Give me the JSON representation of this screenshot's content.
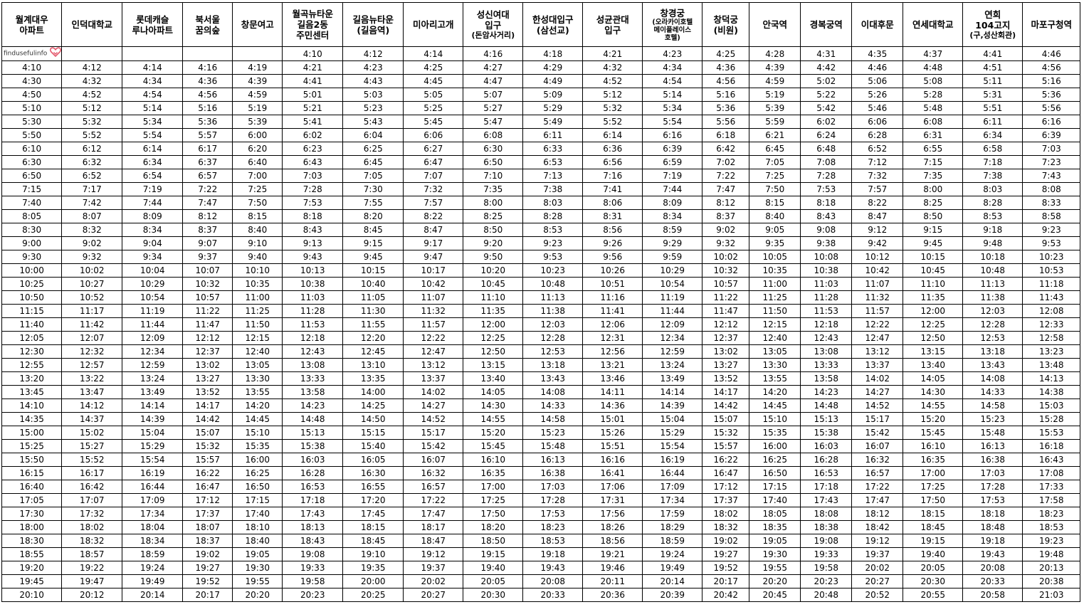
{
  "watermark": {
    "text": "findusefulinfo",
    "icon": "heart-icon",
    "icon_color": "#e45b6e"
  },
  "headers": [
    {
      "main": "월계대우\n아파트"
    },
    {
      "main": "인덕대학교"
    },
    {
      "main": "롯데캐슬\n루나아파트"
    },
    {
      "main": "북서울\n꿈의숲"
    },
    {
      "main": "창문여고"
    },
    {
      "main": "월곡뉴타운\n길음2동\n주민센터"
    },
    {
      "main": "길음뉴타운\n(길음역)"
    },
    {
      "main": "미아리고개"
    },
    {
      "main": "성신여대\n입구",
      "sub": "(돈암사거리)"
    },
    {
      "main": "한성대입구\n(삼선교)"
    },
    {
      "main": "성균관대\n입구"
    },
    {
      "main": "창경궁",
      "tiny": "(오라카이호텔\n메이플레이스\n호텔)"
    },
    {
      "main": "창덕궁\n(비원)"
    },
    {
      "main": "안국역"
    },
    {
      "main": "경복궁역"
    },
    {
      "main": "이대후문"
    },
    {
      "main": "연세대학교"
    },
    {
      "main": "연희\n104고지",
      "sub": "(구,성산회관)"
    },
    {
      "main": "마포구청역"
    }
  ],
  "first_row": [
    "",
    "",
    "",
    "",
    "",
    "4:10",
    "4:12",
    "4:14",
    "4:16",
    "4:18",
    "4:21",
    "4:23",
    "4:25",
    "4:28",
    "4:31",
    "4:35",
    "4:37",
    "4:41",
    "4:46"
  ],
  "rows": [
    [
      "4:10",
      "4:12",
      "4:14",
      "4:16",
      "4:19",
      "4:21",
      "4:23",
      "4:25",
      "4:27",
      "4:29",
      "4:32",
      "4:34",
      "4:36",
      "4:39",
      "4:42",
      "4:46",
      "4:48",
      "4:51",
      "4:56"
    ],
    [
      "4:30",
      "4:32",
      "4:34",
      "4:36",
      "4:39",
      "4:41",
      "4:43",
      "4:45",
      "4:47",
      "4:49",
      "4:52",
      "4:54",
      "4:56",
      "4:59",
      "5:02",
      "5:06",
      "5:08",
      "5:11",
      "5:16"
    ],
    [
      "4:50",
      "4:52",
      "4:54",
      "4:56",
      "4:59",
      "5:01",
      "5:03",
      "5:05",
      "5:07",
      "5:09",
      "5:12",
      "5:14",
      "5:16",
      "5:19",
      "5:22",
      "5:26",
      "5:28",
      "5:31",
      "5:36"
    ],
    [
      "5:10",
      "5:12",
      "5:14",
      "5:16",
      "5:19",
      "5:21",
      "5:23",
      "5:25",
      "5:27",
      "5:29",
      "5:32",
      "5:34",
      "5:36",
      "5:39",
      "5:42",
      "5:46",
      "5:48",
      "5:51",
      "5:56"
    ],
    [
      "5:30",
      "5:32",
      "5:34",
      "5:36",
      "5:39",
      "5:41",
      "5:43",
      "5:45",
      "5:47",
      "5:49",
      "5:52",
      "5:54",
      "5:56",
      "5:59",
      "6:02",
      "6:06",
      "6:08",
      "6:11",
      "6:16"
    ],
    [
      "5:50",
      "5:52",
      "5:54",
      "5:57",
      "6:00",
      "6:02",
      "6:04",
      "6:06",
      "6:08",
      "6:11",
      "6:14",
      "6:16",
      "6:18",
      "6:21",
      "6:24",
      "6:28",
      "6:31",
      "6:34",
      "6:39"
    ],
    [
      "6:10",
      "6:12",
      "6:14",
      "6:17",
      "6:20",
      "6:23",
      "6:25",
      "6:27",
      "6:30",
      "6:33",
      "6:36",
      "6:39",
      "6:42",
      "6:45",
      "6:48",
      "6:52",
      "6:55",
      "6:58",
      "7:03"
    ],
    [
      "6:30",
      "6:32",
      "6:34",
      "6:37",
      "6:40",
      "6:43",
      "6:45",
      "6:47",
      "6:50",
      "6:53",
      "6:56",
      "6:59",
      "7:02",
      "7:05",
      "7:08",
      "7:12",
      "7:15",
      "7:18",
      "7:23"
    ],
    [
      "6:50",
      "6:52",
      "6:54",
      "6:57",
      "7:00",
      "7:03",
      "7:05",
      "7:07",
      "7:10",
      "7:13",
      "7:16",
      "7:19",
      "7:22",
      "7:25",
      "7:28",
      "7:32",
      "7:35",
      "7:38",
      "7:43"
    ],
    [
      "7:15",
      "7:17",
      "7:19",
      "7:22",
      "7:25",
      "7:28",
      "7:30",
      "7:32",
      "7:35",
      "7:38",
      "7:41",
      "7:44",
      "7:47",
      "7:50",
      "7:53",
      "7:57",
      "8:00",
      "8:03",
      "8:08"
    ],
    [
      "7:40",
      "7:42",
      "7:44",
      "7:47",
      "7:50",
      "7:53",
      "7:55",
      "7:57",
      "8:00",
      "8:03",
      "8:06",
      "8:09",
      "8:12",
      "8:15",
      "8:18",
      "8:22",
      "8:25",
      "8:28",
      "8:33"
    ],
    [
      "8:05",
      "8:07",
      "8:09",
      "8:12",
      "8:15",
      "8:18",
      "8:20",
      "8:22",
      "8:25",
      "8:28",
      "8:31",
      "8:34",
      "8:37",
      "8:40",
      "8:43",
      "8:47",
      "8:50",
      "8:53",
      "8:58"
    ],
    [
      "8:30",
      "8:32",
      "8:34",
      "8:37",
      "8:40",
      "8:43",
      "8:45",
      "8:47",
      "8:50",
      "8:53",
      "8:56",
      "8:59",
      "9:02",
      "9:05",
      "9:08",
      "9:12",
      "9:15",
      "9:18",
      "9:23"
    ],
    [
      "9:00",
      "9:02",
      "9:04",
      "9:07",
      "9:10",
      "9:13",
      "9:15",
      "9:17",
      "9:20",
      "9:23",
      "9:26",
      "9:29",
      "9:32",
      "9:35",
      "9:38",
      "9:42",
      "9:45",
      "9:48",
      "9:53"
    ],
    [
      "9:30",
      "9:32",
      "9:34",
      "9:37",
      "9:40",
      "9:43",
      "9:45",
      "9:47",
      "9:50",
      "9:53",
      "9:56",
      "9:59",
      "10:02",
      "10:05",
      "10:08",
      "10:12",
      "10:15",
      "10:18",
      "10:23"
    ],
    [
      "10:00",
      "10:02",
      "10:04",
      "10:07",
      "10:10",
      "10:13",
      "10:15",
      "10:17",
      "10:20",
      "10:23",
      "10:26",
      "10:29",
      "10:32",
      "10:35",
      "10:38",
      "10:42",
      "10:45",
      "10:48",
      "10:53"
    ],
    [
      "10:25",
      "10:27",
      "10:29",
      "10:32",
      "10:35",
      "10:38",
      "10:40",
      "10:42",
      "10:45",
      "10:48",
      "10:51",
      "10:54",
      "10:57",
      "11:00",
      "11:03",
      "11:07",
      "11:10",
      "11:13",
      "11:18"
    ],
    [
      "10:50",
      "10:52",
      "10:54",
      "10:57",
      "11:00",
      "11:03",
      "11:05",
      "11:07",
      "11:10",
      "11:13",
      "11:16",
      "11:19",
      "11:22",
      "11:25",
      "11:28",
      "11:32",
      "11:35",
      "11:38",
      "11:43"
    ],
    [
      "11:15",
      "11:17",
      "11:19",
      "11:22",
      "11:25",
      "11:28",
      "11:30",
      "11:32",
      "11:35",
      "11:38",
      "11:41",
      "11:44",
      "11:47",
      "11:50",
      "11:53",
      "11:57",
      "12:00",
      "12:03",
      "12:08"
    ],
    [
      "11:40",
      "11:42",
      "11:44",
      "11:47",
      "11:50",
      "11:53",
      "11:55",
      "11:57",
      "12:00",
      "12:03",
      "12:06",
      "12:09",
      "12:12",
      "12:15",
      "12:18",
      "12:22",
      "12:25",
      "12:28",
      "12:33"
    ],
    [
      "12:05",
      "12:07",
      "12:09",
      "12:12",
      "12:15",
      "12:18",
      "12:20",
      "12:22",
      "12:25",
      "12:28",
      "12:31",
      "12:34",
      "12:37",
      "12:40",
      "12:43",
      "12:47",
      "12:50",
      "12:53",
      "12:58"
    ],
    [
      "12:30",
      "12:32",
      "12:34",
      "12:37",
      "12:40",
      "12:43",
      "12:45",
      "12:47",
      "12:50",
      "12:53",
      "12:56",
      "12:59",
      "13:02",
      "13:05",
      "13:08",
      "13:12",
      "13:15",
      "13:18",
      "13:23"
    ],
    [
      "12:55",
      "12:57",
      "12:59",
      "13:02",
      "13:05",
      "13:08",
      "13:10",
      "13:12",
      "13:15",
      "13:18",
      "13:21",
      "13:24",
      "13:27",
      "13:30",
      "13:33",
      "13:37",
      "13:40",
      "13:43",
      "13:48"
    ],
    [
      "13:20",
      "13:22",
      "13:24",
      "13:27",
      "13:30",
      "13:33",
      "13:35",
      "13:37",
      "13:40",
      "13:43",
      "13:46",
      "13:49",
      "13:52",
      "13:55",
      "13:58",
      "14:02",
      "14:05",
      "14:08",
      "14:13"
    ],
    [
      "13:45",
      "13:47",
      "13:49",
      "13:52",
      "13:55",
      "13:58",
      "14:00",
      "14:02",
      "14:05",
      "14:08",
      "14:11",
      "14:14",
      "14:17",
      "14:20",
      "14:23",
      "14:27",
      "14:30",
      "14:33",
      "14:38"
    ],
    [
      "14:10",
      "14:12",
      "14:14",
      "14:17",
      "14:20",
      "14:23",
      "14:25",
      "14:27",
      "14:30",
      "14:33",
      "14:36",
      "14:39",
      "14:42",
      "14:45",
      "14:48",
      "14:52",
      "14:55",
      "14:58",
      "15:03"
    ],
    [
      "14:35",
      "14:37",
      "14:39",
      "14:42",
      "14:45",
      "14:48",
      "14:50",
      "14:52",
      "14:55",
      "14:58",
      "15:01",
      "15:04",
      "15:07",
      "15:10",
      "15:13",
      "15:17",
      "15:20",
      "15:23",
      "15:28"
    ],
    [
      "15:00",
      "15:02",
      "15:04",
      "15:07",
      "15:10",
      "15:13",
      "15:15",
      "15:17",
      "15:20",
      "15:23",
      "15:26",
      "15:29",
      "15:32",
      "15:35",
      "15:38",
      "15:42",
      "15:45",
      "15:48",
      "15:53"
    ],
    [
      "15:25",
      "15:27",
      "15:29",
      "15:32",
      "15:35",
      "15:38",
      "15:40",
      "15:42",
      "15:45",
      "15:48",
      "15:51",
      "15:54",
      "15:57",
      "16:00",
      "16:03",
      "16:07",
      "16:10",
      "16:13",
      "16:18"
    ],
    [
      "15:50",
      "15:52",
      "15:54",
      "15:57",
      "16:00",
      "16:03",
      "16:05",
      "16:07",
      "16:10",
      "16:13",
      "16:16",
      "16:19",
      "16:22",
      "16:25",
      "16:28",
      "16:32",
      "16:35",
      "16:38",
      "16:43"
    ],
    [
      "16:15",
      "16:17",
      "16:19",
      "16:22",
      "16:25",
      "16:28",
      "16:30",
      "16:32",
      "16:35",
      "16:38",
      "16:41",
      "16:44",
      "16:47",
      "16:50",
      "16:53",
      "16:57",
      "17:00",
      "17:03",
      "17:08"
    ],
    [
      "16:40",
      "16:42",
      "16:44",
      "16:47",
      "16:50",
      "16:53",
      "16:55",
      "16:57",
      "17:00",
      "17:03",
      "17:06",
      "17:09",
      "17:12",
      "17:15",
      "17:18",
      "17:22",
      "17:25",
      "17:28",
      "17:33"
    ],
    [
      "17:05",
      "17:07",
      "17:09",
      "17:12",
      "17:15",
      "17:18",
      "17:20",
      "17:22",
      "17:25",
      "17:28",
      "17:31",
      "17:34",
      "17:37",
      "17:40",
      "17:43",
      "17:47",
      "17:50",
      "17:53",
      "17:58"
    ],
    [
      "17:30",
      "17:32",
      "17:34",
      "17:37",
      "17:40",
      "17:43",
      "17:45",
      "17:47",
      "17:50",
      "17:53",
      "17:56",
      "17:59",
      "18:02",
      "18:05",
      "18:08",
      "18:12",
      "18:15",
      "18:18",
      "18:23"
    ],
    [
      "18:00",
      "18:02",
      "18:04",
      "18:07",
      "18:10",
      "18:13",
      "18:15",
      "18:17",
      "18:20",
      "18:23",
      "18:26",
      "18:29",
      "18:32",
      "18:35",
      "18:38",
      "18:42",
      "18:45",
      "18:48",
      "18:53"
    ],
    [
      "18:30",
      "18:32",
      "18:34",
      "18:37",
      "18:40",
      "18:43",
      "18:45",
      "18:47",
      "18:50",
      "18:53",
      "18:56",
      "18:59",
      "19:02",
      "19:05",
      "19:08",
      "19:12",
      "19:15",
      "19:18",
      "19:23"
    ],
    [
      "18:55",
      "18:57",
      "18:59",
      "19:02",
      "19:05",
      "19:08",
      "19:10",
      "19:12",
      "19:15",
      "19:18",
      "19:21",
      "19:24",
      "19:27",
      "19:30",
      "19:33",
      "19:37",
      "19:40",
      "19:43",
      "19:48"
    ],
    [
      "19:20",
      "19:22",
      "19:24",
      "19:27",
      "19:30",
      "19:33",
      "19:35",
      "19:37",
      "19:40",
      "19:43",
      "19:46",
      "19:49",
      "19:52",
      "19:55",
      "19:58",
      "20:02",
      "20:05",
      "20:08",
      "20:13"
    ],
    [
      "19:45",
      "19:47",
      "19:49",
      "19:52",
      "19:55",
      "19:58",
      "20:00",
      "20:02",
      "20:05",
      "20:08",
      "20:11",
      "20:14",
      "20:17",
      "20:20",
      "20:23",
      "20:27",
      "20:30",
      "20:33",
      "20:38"
    ],
    [
      "20:10",
      "20:12",
      "20:14",
      "20:17",
      "20:20",
      "20:23",
      "20:25",
      "20:27",
      "20:30",
      "20:33",
      "20:36",
      "20:39",
      "20:42",
      "20:45",
      "20:48",
      "20:52",
      "20:55",
      "20:58",
      "21:03"
    ]
  ]
}
